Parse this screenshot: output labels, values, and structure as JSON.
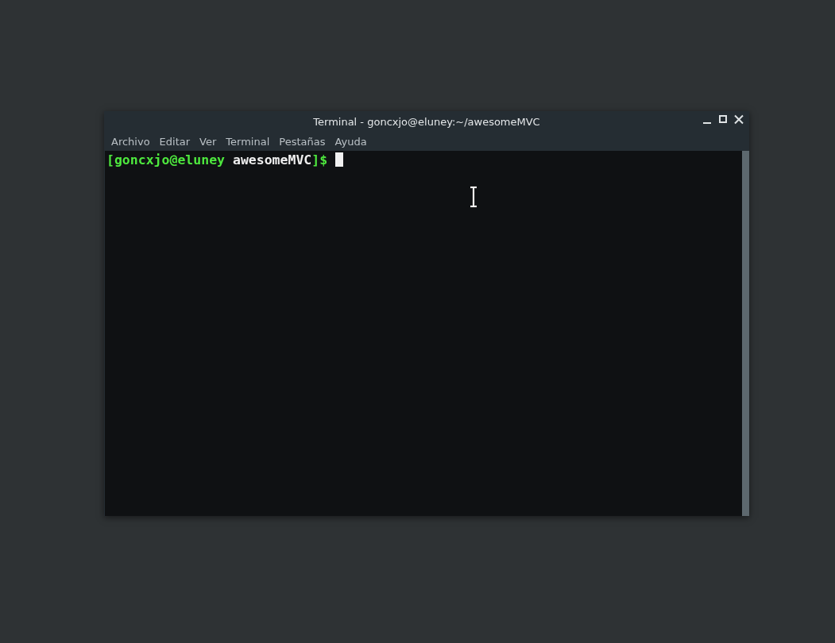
{
  "window": {
    "title": "Terminal - goncxjo@eluney:~/awesomeMVC"
  },
  "menu": [
    "Archivo",
    "Editar",
    "Ver",
    "Terminal",
    "Pestañas",
    "Ayuda"
  ],
  "terminal": {
    "prompt": {
      "user_host": "[goncxjo@eluney",
      "directory": "awesomeMVC",
      "suffix": "]$"
    }
  }
}
